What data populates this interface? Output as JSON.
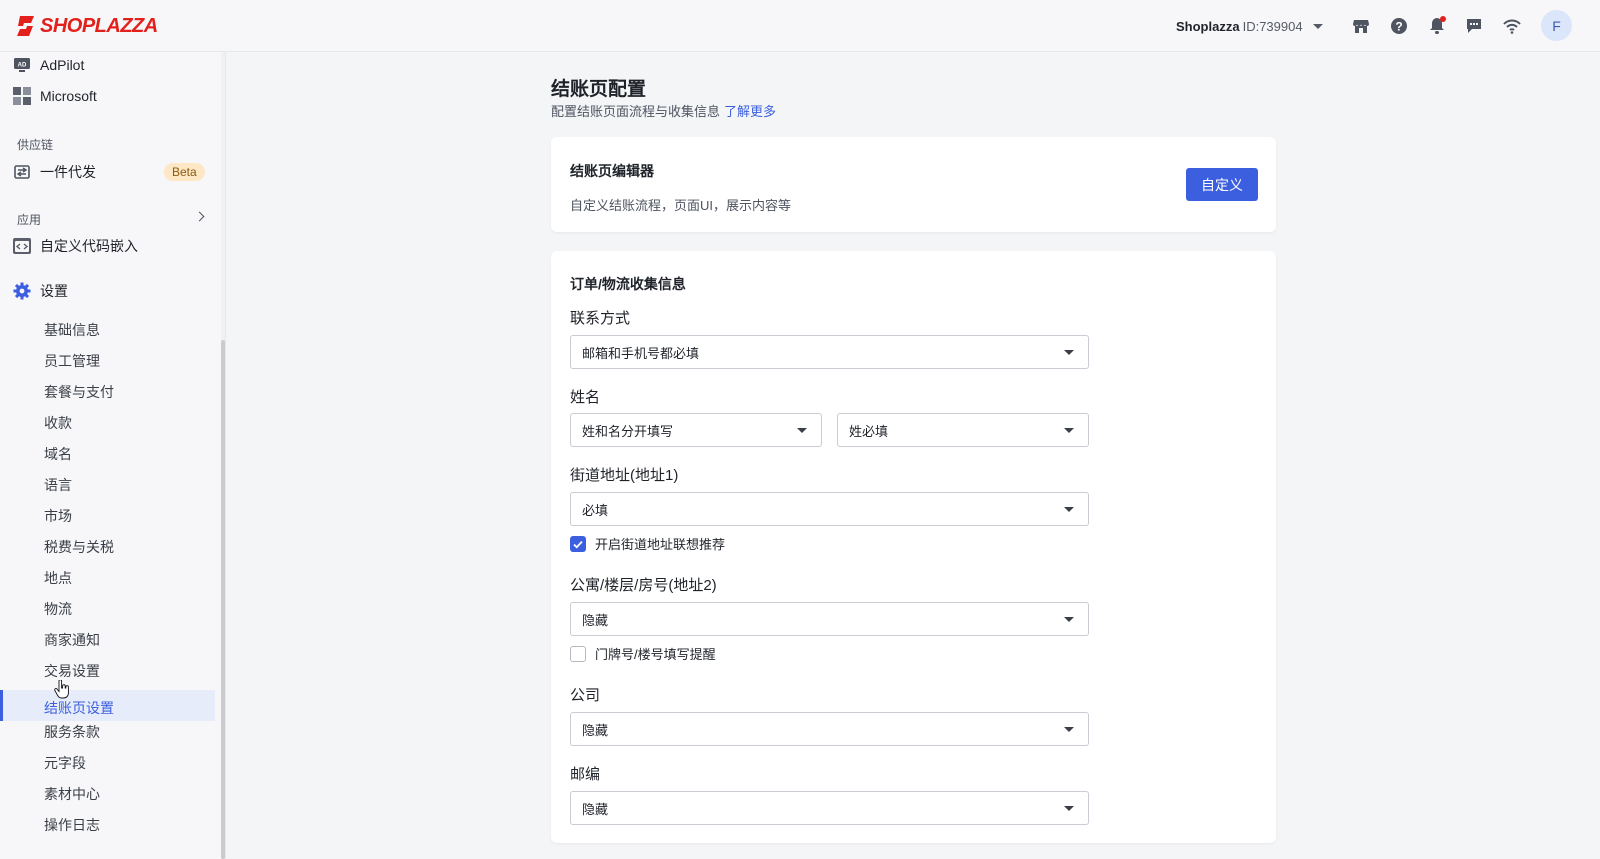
{
  "header": {
    "brand": "SHOPLAZZA",
    "store_name": "Shoplazza",
    "store_id": "ID:739904",
    "avatar_initial": "F",
    "brand_color": "#e2211c",
    "icons": [
      "store-icon",
      "help-icon",
      "bell-icon",
      "chat-icon",
      "wifi-icon"
    ]
  },
  "sidebar": {
    "apps_top": [
      {
        "label": "AdPilot",
        "icon": "ad-icon"
      },
      {
        "label": "Microsoft",
        "icon": "microsoft-icon"
      }
    ],
    "supply_section": "供应链",
    "dropship": {
      "label": "一件代发",
      "badge": "Beta"
    },
    "apps_section": "应用",
    "custom_code": {
      "label": "自定义代码嵌入"
    },
    "settings": {
      "label": "设置"
    },
    "settings_items": [
      "基础信息",
      "员工管理",
      "套餐与支付",
      "收款",
      "域名",
      "语言",
      "市场",
      "税费与关税",
      "地点",
      "物流",
      "商家通知",
      "交易设置",
      "结账页设置",
      "服务条款",
      "元字段",
      "素材中心",
      "操作日志"
    ],
    "active_item": "结账页设置",
    "accent_color": "#3c5fe0"
  },
  "main": {
    "title": "结账页配置",
    "subtitle": "配置结账页面流程与收集信息",
    "learn_more": "了解更多",
    "editor_card": {
      "title": "结账页编辑器",
      "desc": "自定义结账流程，页面UI，展示内容等",
      "button": "自定义"
    },
    "collect_card": {
      "title": "订单/物流收集信息",
      "contact": {
        "label": "联系方式",
        "value": "邮箱和手机号都必填"
      },
      "name": {
        "label": "姓名",
        "value1": "姓和名分开填写",
        "value2": "姓必填"
      },
      "address1": {
        "label": "街道地址(地址1)",
        "value": "必填",
        "checkbox": "开启街道地址联想推荐",
        "checked": true
      },
      "address2": {
        "label": "公寓/楼层/房号(地址2)",
        "value": "隐藏",
        "checkbox": "门牌号/楼号填写提醒",
        "checked": false
      },
      "company": {
        "label": "公司",
        "value": "隐藏"
      },
      "zip": {
        "label": "邮编",
        "value": "隐藏"
      }
    }
  }
}
